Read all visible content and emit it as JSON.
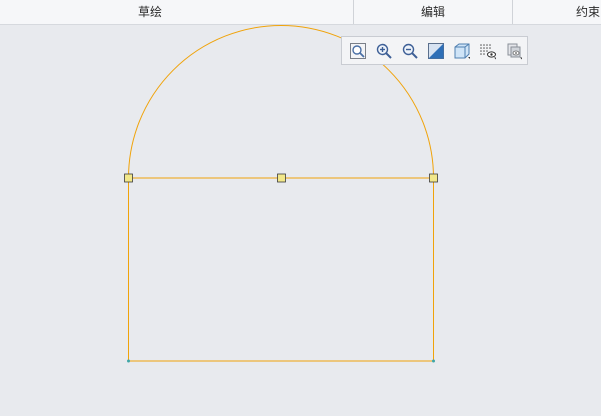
{
  "tabs": [
    {
      "label": "草绘"
    },
    {
      "label": "编辑"
    },
    {
      "label": "约束"
    }
  ],
  "toolbar": {
    "tools": [
      {
        "icon": "zoom-fit-icon"
      },
      {
        "icon": "zoom-in-icon"
      },
      {
        "icon": "zoom-out-icon"
      },
      {
        "icon": "repaint-icon"
      },
      {
        "icon": "display-style-icon"
      },
      {
        "icon": "sketch-display-icon"
      },
      {
        "icon": "orientation-icon"
      }
    ]
  },
  "colors": {
    "sketch_line": "#f0a30a",
    "endpoint_fill": "#f2e88a",
    "endpoint_stroke": "#3a3a3a",
    "vertex": "#3fa6a6"
  }
}
